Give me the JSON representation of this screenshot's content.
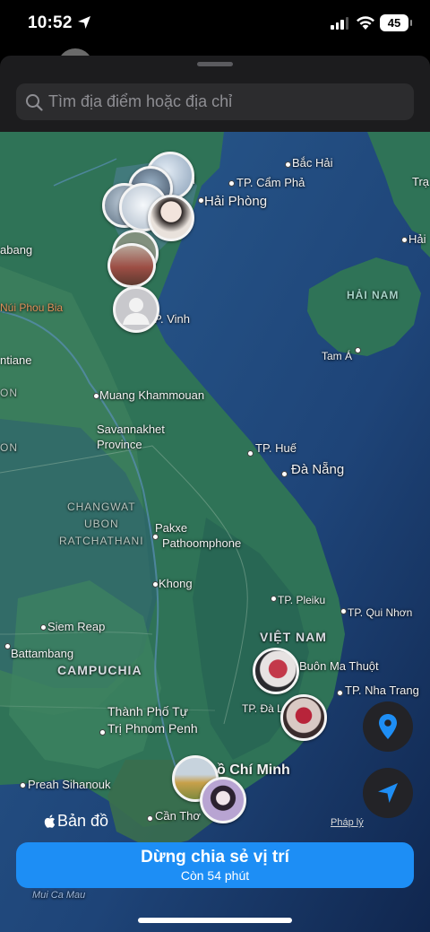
{
  "status_bar": {
    "time": "10:52",
    "battery": "45"
  },
  "search": {
    "placeholder": "Tìm địa điểm hoặc địa chỉ"
  },
  "map": {
    "labels": {
      "bac_hai": "Bắc Hải",
      "cam_pha": "TP. Cẩm Phả",
      "trang": "Trạ",
      "hai_phong": "Hải Phòng",
      "hai_i": "Hải",
      "abang": "abang",
      "hai_nam": "HẢI NAM",
      "nui_phou_bia": "Núi Phou Bia",
      "vinh": "P. Vinh",
      "tiane": "ntiane",
      "tam_a": "Tam Á",
      "on1": "ON",
      "muang_khammouan": "Muang Khammouan",
      "savannakhet": "Savannakhet\nProvince",
      "on2": "ON",
      "hue": "TP. Huế",
      "da_nang": "Đà Nẵng",
      "changwat": "CHANGWAT\nUBON\nRATCHATHANI",
      "pakxe": "Pakxe",
      "pathoomphone": "Pathoomphone",
      "khong": "Khong",
      "pleiku": "TP. Pleiku",
      "qui_nhon": "TP. Qui Nhơn",
      "siem_reap": "Siem Reap",
      "viet_nam": "VIỆT NAM",
      "battambang": "Battambang",
      "buon_ma_thuot": "Buôn Ma Thuột",
      "campuchia": "CAMPUCHIA",
      "nha_trang": "TP. Nha Trang",
      "phnom_penh": "Thành Phố Tự\nTrị Phnom Penh",
      "da_lat": "TP. Đà L",
      "ho_chi_minh": "ồ Chí Minh",
      "sihanouk": "Preah Sihanouk",
      "can_tho": "Cần Thơ",
      "mui_ca_mau": "Mui Ca Mau",
      "i_label": "i"
    }
  },
  "attribution": {
    "maps_logo": "Bản đồ",
    "legal": "Pháp lý"
  },
  "share": {
    "title": "Dừng chia sẻ vị trí",
    "subtitle": "Còn 54 phút"
  }
}
